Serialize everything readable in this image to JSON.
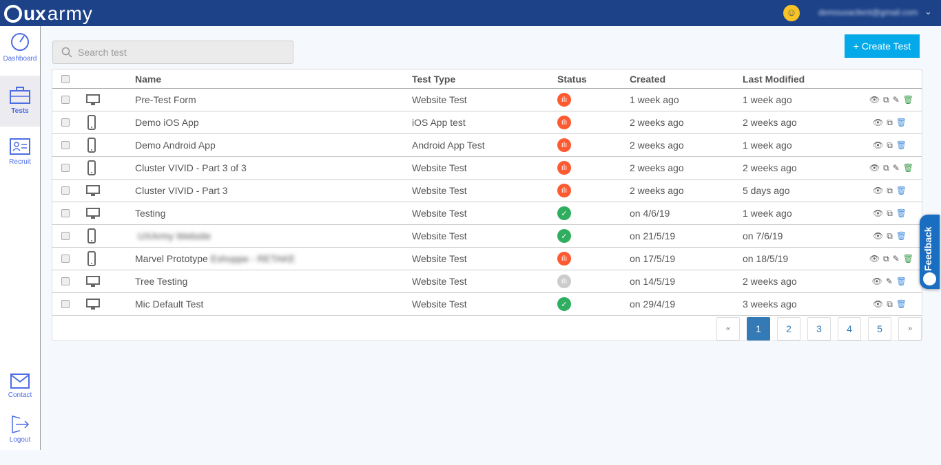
{
  "header": {
    "logo": "uxarmy",
    "email": "demouxaclient@gmail.com"
  },
  "sidebar": {
    "items": [
      {
        "label": "Dashboard"
      },
      {
        "label": "Tests"
      },
      {
        "label": "Recruit"
      },
      {
        "label": "Contact"
      },
      {
        "label": "Logout"
      }
    ]
  },
  "search": {
    "placeholder": "Search test"
  },
  "create_button": "+ Create Test",
  "table": {
    "columns": [
      "Name",
      "Test Type",
      "Status",
      "Created",
      "Last Modified"
    ],
    "rows": [
      {
        "device": "desktop",
        "name": "Pre-Test Form",
        "type": "Website Test",
        "status": "running",
        "created": "1 week ago",
        "modified": "1 week ago",
        "actions": [
          "view",
          "copy",
          "edit",
          "delete"
        ]
      },
      {
        "device": "mobile",
        "name": "Demo iOS App",
        "type": "iOS App test",
        "status": "running",
        "created": "2 weeks ago",
        "modified": "2 weeks ago",
        "actions": [
          "view",
          "copy",
          "delete"
        ]
      },
      {
        "device": "mobile",
        "name": "Demo Android App",
        "type": "Android App Test",
        "status": "running",
        "created": "2 weeks ago",
        "modified": "1 week ago",
        "actions": [
          "view",
          "copy",
          "delete"
        ]
      },
      {
        "device": "mobile",
        "name": "Cluster VIVID - Part 3 of 3",
        "type": "Website Test",
        "status": "running",
        "created": "2 weeks ago",
        "modified": "2 weeks ago",
        "actions": [
          "view",
          "copy",
          "edit",
          "delete"
        ]
      },
      {
        "device": "desktop",
        "name": "Cluster VIVID - Part 3",
        "type": "Website Test",
        "status": "running",
        "created": "2 weeks ago",
        "modified": "5 days ago",
        "actions": [
          "view",
          "copy",
          "delete"
        ]
      },
      {
        "device": "desktop",
        "name": "Testing",
        "type": "Website Test",
        "status": "completed",
        "created": "on 4/6/19",
        "modified": "1 week ago",
        "actions": [
          "view",
          "copy",
          "delete"
        ]
      },
      {
        "device": "mobile",
        "name": "",
        "name_blurred": "UXArmy Website",
        "type": "Website Test",
        "status": "completed",
        "created": "on 21/5/19",
        "modified": "on 7/6/19",
        "actions": [
          "view",
          "copy",
          "delete"
        ]
      },
      {
        "device": "mobile",
        "name": "Marvel Prototype",
        "name_blurred": "Eshoppe - RETAKE",
        "type": "Website Test",
        "status": "running",
        "created": "on 17/5/19",
        "modified": "on 18/5/19",
        "actions": [
          "view",
          "copy",
          "edit",
          "delete"
        ]
      },
      {
        "device": "desktop",
        "name": "Tree Testing",
        "type": "Website Test",
        "status": "draft",
        "created": "on 14/5/19",
        "modified": "2 weeks ago",
        "actions": [
          "view",
          "edit",
          "delete"
        ]
      },
      {
        "device": "desktop",
        "name": "Mic Default Test",
        "type": "Website Test",
        "status": "completed",
        "created": "on 29/4/19",
        "modified": "3 weeks ago",
        "actions": [
          "view",
          "copy",
          "delete"
        ]
      }
    ]
  },
  "pagination": {
    "prev": "«",
    "pages": [
      "1",
      "2",
      "3",
      "4",
      "5"
    ],
    "current": "1",
    "next": "»"
  },
  "feedback": "Feedback",
  "colors": {
    "topbar": "#1d4288",
    "accent": "#03a9e8",
    "running": "#fc5b32",
    "completed": "#2fae60",
    "draft": "#cccccc"
  }
}
